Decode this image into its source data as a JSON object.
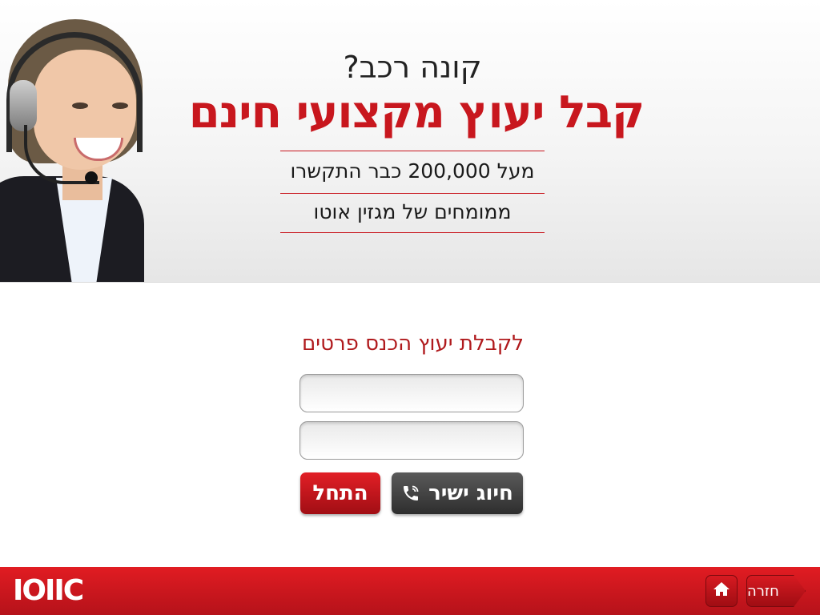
{
  "hero": {
    "headline_small": "קונה רכב?",
    "headline_big": "קבל יעוץ מקצועי חינם",
    "stat_1": "מעל 200,000 כבר התקשרו",
    "stat_2": "ממומחים של מגזין אוטו",
    "accent_color": "#c8171e"
  },
  "form": {
    "title": "לקבלת יעוץ הכנס פרטים",
    "name_value": "",
    "phone_value": "",
    "direct_dial_label": "חיוג ישיר",
    "start_label": "התחל"
  },
  "footer": {
    "logo_text": "IOIIC",
    "back_label": "חזרה",
    "home_icon": "home-icon",
    "bar_color": "#d0161d"
  }
}
